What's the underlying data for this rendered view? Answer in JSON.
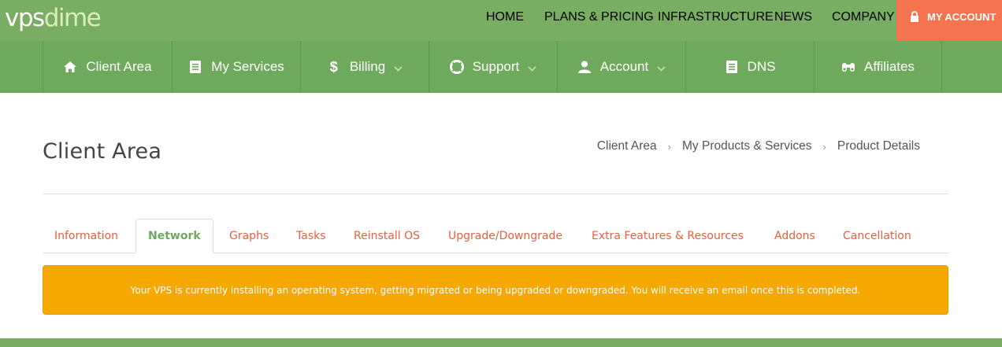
{
  "brand": {
    "logo_part1": "vps",
    "logo_part2": "dime"
  },
  "top_nav": {
    "home": "HOME",
    "plans": "PLANS & PRICING",
    "infrastructure": "INFRASTRUCTURE",
    "news": "NEWS",
    "company": "COMPANY",
    "my_account": "MY ACCOUNT"
  },
  "main_nav": [
    {
      "label": "Client Area",
      "icon": "home-icon"
    },
    {
      "label": "My Services",
      "icon": "list-icon"
    },
    {
      "label": "Billing",
      "icon": "dollar-icon",
      "dropdown": true
    },
    {
      "label": "Support",
      "icon": "lifebuoy-icon",
      "dropdown": true
    },
    {
      "label": "Account",
      "icon": "user-icon",
      "dropdown": true
    },
    {
      "label": "DNS",
      "icon": "list-icon"
    },
    {
      "label": "Affiliates",
      "icon": "binoculars-icon"
    }
  ],
  "page": {
    "title": "Client Area",
    "breadcrumb": [
      "Client Area",
      "My Products & Services",
      "Product Details"
    ]
  },
  "tabs": [
    {
      "label": "Information",
      "active": false
    },
    {
      "label": "Network",
      "active": true
    },
    {
      "label": "Graphs",
      "active": false
    },
    {
      "label": "Tasks",
      "active": false
    },
    {
      "label": "Reinstall OS",
      "active": false
    },
    {
      "label": "Upgrade/Downgrade",
      "active": false
    },
    {
      "label": "Extra Features & Resources",
      "active": false
    },
    {
      "label": "Addons",
      "active": false
    },
    {
      "label": "Cancellation",
      "active": false
    }
  ],
  "alert": {
    "message": "Your VPS is currently installing an operating system, getting migrated or being upgraded or downgraded. You will receive an email once this is completed."
  },
  "colors": {
    "header_green": "#79ad63",
    "nav_green": "#6fa95d",
    "accent_orange": "#f5734f",
    "tab_link": "#e8613d",
    "alert_bg": "#f4a800"
  }
}
